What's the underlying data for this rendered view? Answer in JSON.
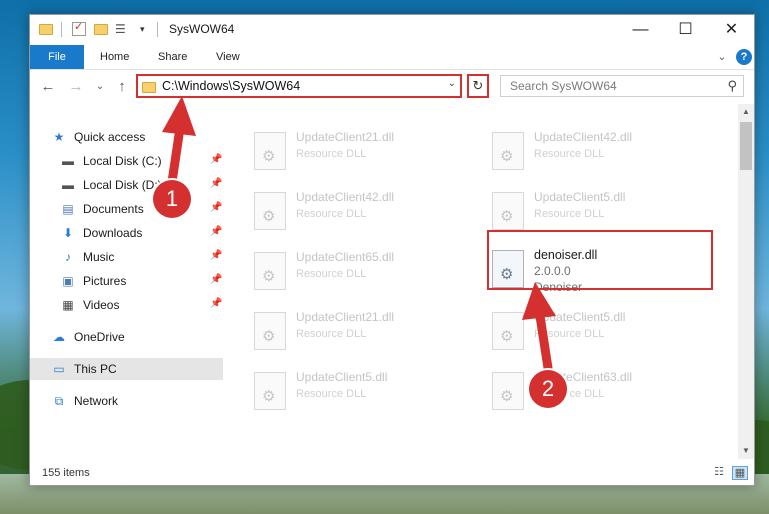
{
  "window": {
    "title": "SysWOW64"
  },
  "ribbon": {
    "tabs": [
      "File",
      "Home",
      "Share",
      "View"
    ],
    "expand_glyph": "⌄",
    "help_glyph": "?"
  },
  "window_controls": {
    "minimize": "—",
    "maximize": "☐",
    "close": "✕"
  },
  "nav": {
    "back_glyph": "←",
    "forward_glyph": "→",
    "recent_glyph": "⌄",
    "up_glyph": "↑",
    "address": "C:\\Windows\\SysWOW64",
    "address_dropdown_glyph": "⌄",
    "refresh_glyph": "↻",
    "search_placeholder": "Search SysWOW64",
    "search_glyph": "⚲"
  },
  "sidebar": {
    "items": [
      {
        "label": "Quick access",
        "icon": "star-icon",
        "glyph": "★",
        "color": "#2b7cd3",
        "pinned": false,
        "level": 0
      },
      {
        "label": "Local Disk (C:)",
        "icon": "drive-icon",
        "glyph": "▬",
        "color": "#555555",
        "pinned": true,
        "level": 1
      },
      {
        "label": "Local Disk (D:)",
        "icon": "drive-icon",
        "glyph": "▬",
        "color": "#555555",
        "pinned": true,
        "level": 1
      },
      {
        "label": "Documents",
        "icon": "documents-icon",
        "glyph": "▤",
        "color": "#4a7ab8",
        "pinned": true,
        "level": 1
      },
      {
        "label": "Downloads",
        "icon": "downloads-icon",
        "glyph": "⬇",
        "color": "#2b7cd3",
        "pinned": true,
        "level": 1
      },
      {
        "label": "Music",
        "icon": "music-icon",
        "glyph": "♪",
        "color": "#2b7cd3",
        "pinned": true,
        "level": 1
      },
      {
        "label": "Pictures",
        "icon": "pictures-icon",
        "glyph": "▣",
        "color": "#4a7ab8",
        "pinned": true,
        "level": 1
      },
      {
        "label": "Videos",
        "icon": "videos-icon",
        "glyph": "▦",
        "color": "#444444",
        "pinned": true,
        "level": 1
      },
      {
        "label": "OneDrive",
        "icon": "cloud-icon",
        "glyph": "☁",
        "color": "#2b7cd3",
        "pinned": false,
        "level": 0
      },
      {
        "label": "This PC",
        "icon": "computer-icon",
        "glyph": "▭",
        "color": "#2b7cd3",
        "pinned": false,
        "level": 0
      },
      {
        "label": "Network",
        "icon": "network-icon",
        "glyph": "⧉",
        "color": "#2b7cd3",
        "pinned": false,
        "level": 0
      }
    ],
    "pin_glyph": "📌"
  },
  "files": [
    {
      "name": "UpdateClient21.dll",
      "desc": "Resource DLL"
    },
    {
      "name": "UpdateClient42.dll",
      "desc": "Resource DLL"
    },
    {
      "name": "UpdateClient42.dll",
      "desc": "Resource DLL"
    },
    {
      "name": "UpdateClient5.dll",
      "desc": "Resource DLL"
    },
    {
      "name": "UpdateClient65.dll",
      "desc": "Resource DLL"
    },
    {
      "name": "UpdateClient21.dll",
      "desc": "Resource DLL"
    },
    {
      "name": "UpdateClient5.dll",
      "desc": "Resource DLL"
    },
    {
      "name": "UpdateClient5.dll",
      "desc": "Resource DLL"
    },
    {
      "name": "UpdateClient63.dll",
      "desc": "Resource DLL"
    }
  ],
  "highlighted_file": {
    "name": "denoiser.dll",
    "version": "2.0.0.0",
    "desc": "Denoiser"
  },
  "status": {
    "item_count": "155 items"
  },
  "annotations": {
    "step1": "1",
    "step2": "2",
    "color": "#d3302f"
  }
}
